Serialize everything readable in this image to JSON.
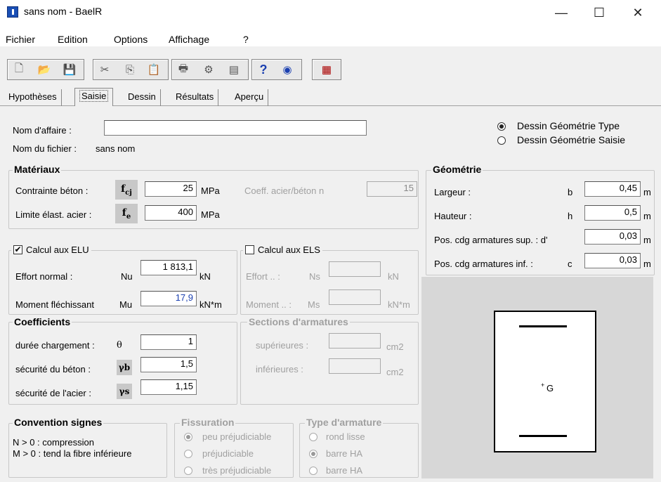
{
  "window": {
    "title": "sans nom - BaelR",
    "min": "—",
    "max": "☐",
    "close": "✕"
  },
  "menu": [
    "Fichier",
    "Edition",
    "Options",
    "Affichage",
    "?"
  ],
  "toolbar_icons": [
    "new-icon",
    "open-icon",
    "save-icon",
    "cut-icon",
    "copy-icon",
    "paste-icon",
    "print-icon",
    "print-setup-icon",
    "preview-icon",
    "help-icon",
    "web-icon",
    "calculator-icon"
  ],
  "tabs": [
    "Hypothèses",
    "Saisie",
    "Dessin",
    "Résultats",
    "Aperçu"
  ],
  "header": {
    "affaire_label": "Nom d'affaire :",
    "affaire_value": "",
    "fichier_label": "Nom du fichier :",
    "fichier_value": "sans nom",
    "radio_type": "Dessin Géométrie Type",
    "radio_saisie": "Dessin Géométrie Saisie"
  },
  "materiaux": {
    "title": "Matériaux",
    "beton_label": "Contrainte béton :",
    "beton_sym": "fcj",
    "beton_value": "25",
    "beton_unit": "MPa",
    "coeff_label": "Coeff. acier/béton  n",
    "coeff_value": "15",
    "acier_label": "Limite élast. acier :",
    "acier_sym": "fe",
    "acier_value": "400",
    "acier_unit": "MPa"
  },
  "geometrie": {
    "title": "Géométrie",
    "rows": [
      {
        "label": "Largeur :",
        "sym": "b",
        "value": "0,45",
        "unit": "m"
      },
      {
        "label": "Hauteur :",
        "sym": "h",
        "value": "0,5",
        "unit": "m"
      },
      {
        "label": "Pos. cdg armatures sup. : d'",
        "sym": "",
        "value": "0,03",
        "unit": "m"
      },
      {
        "label": "Pos. cdg armatures inf. :",
        "sym": "c",
        "value": "0,03",
        "unit": "m"
      }
    ]
  },
  "elu": {
    "title": "Calcul aux ELU",
    "checked": "✔",
    "effort_label": "Effort normal :",
    "effort_sym": "Nu",
    "effort_value": "1 813,1",
    "effort_unit": "kN",
    "moment_label": "Moment fléchissant",
    "moment_sym": "Mu",
    "moment_value": "17,9",
    "moment_unit": "kN*m"
  },
  "els": {
    "title": "Calcul aux ELS",
    "effort_label": "Effort .. :",
    "effort_sym": "Ns",
    "effort_unit": "kN",
    "moment_label": "Moment .. :",
    "moment_sym": "Ms",
    "moment_unit": "kN*m"
  },
  "coefficients": {
    "title": "Coefficients",
    "rows": [
      {
        "label": "durée chargement :",
        "sym": "θ",
        "value": "1"
      },
      {
        "label": "sécurité du béton :",
        "sym": "γb",
        "value": "1,5"
      },
      {
        "label": "sécurité de l'acier :",
        "sym": "γs",
        "value": "1,15"
      }
    ]
  },
  "sections": {
    "title": "Sections d'armatures",
    "sup_label": "supérieures :",
    "inf_label": "inférieures :",
    "unit": "cm2"
  },
  "convention": {
    "title": "Convention signes",
    "line1": "N > 0 : compression",
    "line2": "M > 0 : tend la fibre inférieure"
  },
  "fissuration": {
    "title": "Fissuration",
    "options": [
      "peu préjudiciable",
      "préjudiciable",
      "très préjudiciable"
    ]
  },
  "armature": {
    "title": "Type d'armature",
    "options": [
      "rond lisse",
      "barre HA",
      "barre HA"
    ]
  },
  "preview": {
    "g_label": "G",
    "g_mark": "+"
  }
}
